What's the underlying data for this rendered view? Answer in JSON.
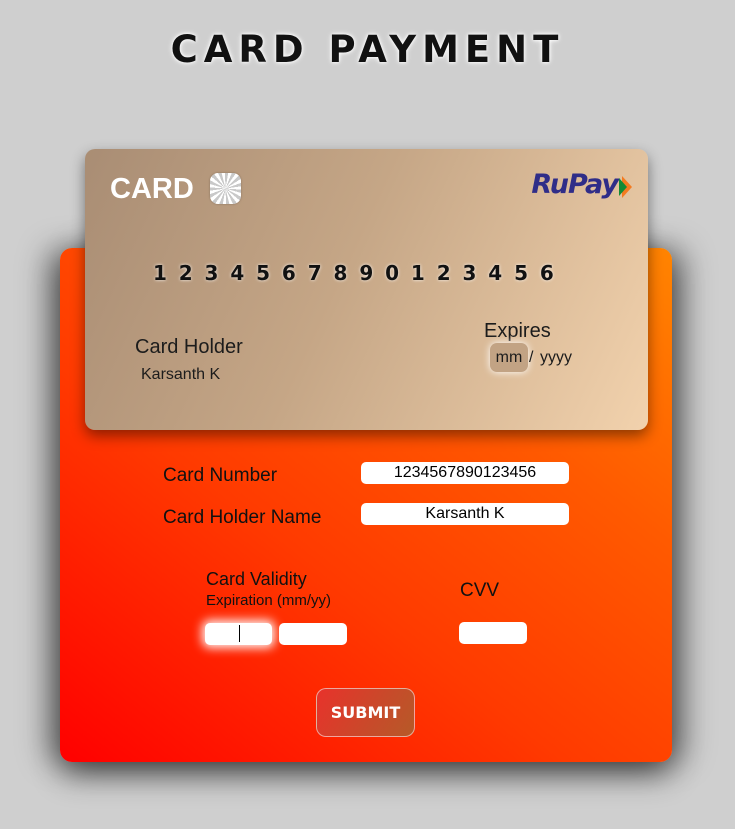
{
  "page": {
    "title": "CARD PAYMENT"
  },
  "card": {
    "label": "CARD",
    "brand": "RuPay",
    "digits": [
      "1",
      "2",
      "3",
      "4",
      "5",
      "6",
      "7",
      "8",
      "9",
      "0",
      "1",
      "2",
      "3",
      "4",
      "5",
      "6"
    ],
    "holder_title": "Card Holder",
    "holder_value": "Karsanth K",
    "expires_title": "Expires",
    "exp_month": "mm",
    "exp_separator": "/",
    "exp_year": "yyyy"
  },
  "form": {
    "card_number_label": "Card Number",
    "card_number_value": "1234567890123456",
    "holder_name_label": "Card Holder Name",
    "holder_name_value": "Karsanth K",
    "validity_label": "Card Validity",
    "validity_hint": "Expiration (mm/yy)",
    "month_value": "",
    "year_value": "",
    "cvv_label": "CVV",
    "cvv_value": "",
    "submit_label": "SUBMIT"
  },
  "colors": {
    "background": "#cfcfcf",
    "panel_start": "#ff0000",
    "panel_end": "#ff8400",
    "brand": "#2f2d88"
  },
  "icons": [
    "card-chip-icon",
    "rupay-logo-icon"
  ]
}
